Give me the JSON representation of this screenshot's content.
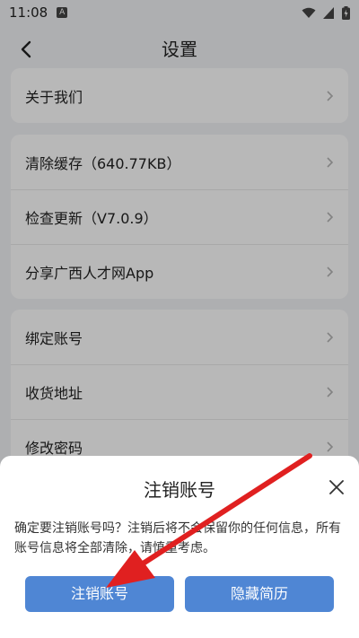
{
  "status": {
    "time": "11:08",
    "badge": "A"
  },
  "header": {
    "title": "设置"
  },
  "sections": {
    "about": {
      "label": "关于我们"
    },
    "cache": {
      "label": "清除缓存（640.77KB）"
    },
    "update": {
      "label": "检查更新（V7.0.9）"
    },
    "share": {
      "label": "分享广西人才网App"
    },
    "bind": {
      "label": "绑定账号"
    },
    "address": {
      "label": "收货地址"
    },
    "password": {
      "label": "修改密码"
    }
  },
  "dialog": {
    "title": "注销账号",
    "message": "确定要注销账号吗？注销后将不会保留你的任何信息，所有账号信息将全部清除，请慎重考虑。",
    "confirm_label": "注销账号",
    "hide_label": "隐藏简历"
  },
  "colors": {
    "accent": "#4f86d4",
    "annotation_arrow": "#e02020"
  }
}
